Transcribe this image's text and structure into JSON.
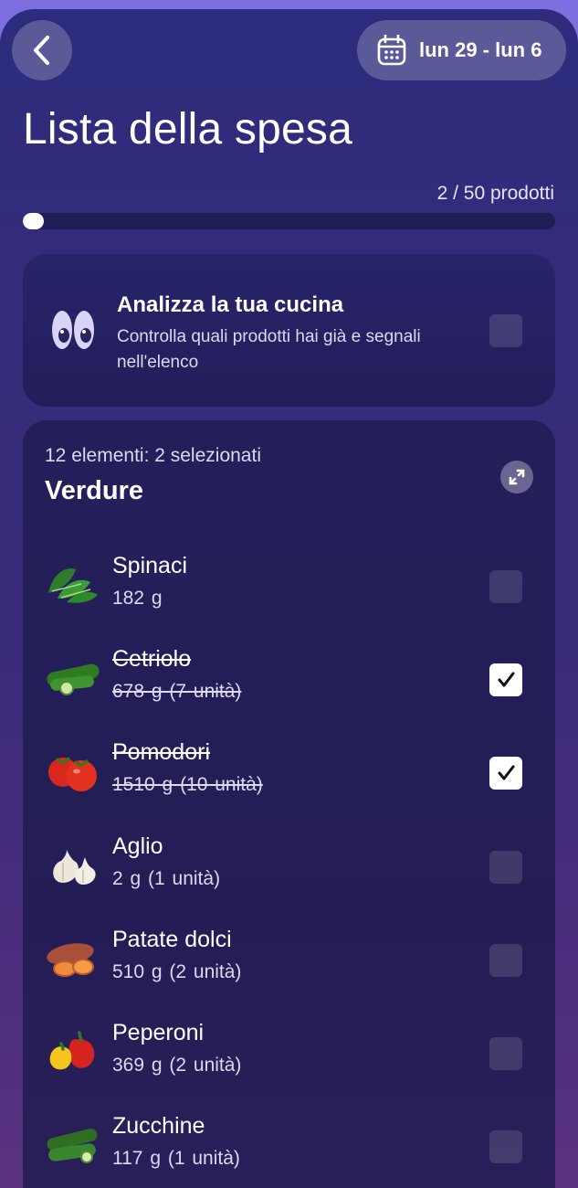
{
  "header": {
    "date_range": "lun 29 - lun 6",
    "title": "Lista della spesa"
  },
  "progress": {
    "label": "2 / 50 prodotti",
    "fraction": 0.04
  },
  "analyze": {
    "title": "Analizza la tua cucina",
    "description": "Controlla quali prodotti hai già e segnali nell'elenco",
    "checked": false
  },
  "list": {
    "meta": "12 elementi: 2 selezionati",
    "category": "Verdure",
    "items": [
      {
        "name": "Spinaci",
        "qty": "182 g",
        "icon": "spinach-icon",
        "checked": false
      },
      {
        "name": "Cetriolo",
        "qty": "678 g  (7 unità)",
        "icon": "cucumber-icon",
        "checked": true
      },
      {
        "name": "Pomodori",
        "qty": "1510 g  (10 unità)",
        "icon": "tomato-icon",
        "checked": true
      },
      {
        "name": "Aglio",
        "qty": "2 g  (1 unità)",
        "icon": "garlic-icon",
        "checked": false
      },
      {
        "name": "Patate dolci",
        "qty": "510 g  (2 unità)",
        "icon": "sweet-potato-icon",
        "checked": false
      },
      {
        "name": "Peperoni",
        "qty": "369 g  (2 unità)",
        "icon": "pepper-icon",
        "checked": false
      },
      {
        "name": "Zucchine",
        "qty": "117 g  (1 unità)",
        "icon": "zucchini-icon",
        "checked": false
      }
    ]
  },
  "colors": {
    "page_top": "#7e6fe0",
    "screen_bg": "#2d2c7c",
    "card_bg": "#231f5c",
    "accent_white": "#ffffff"
  }
}
